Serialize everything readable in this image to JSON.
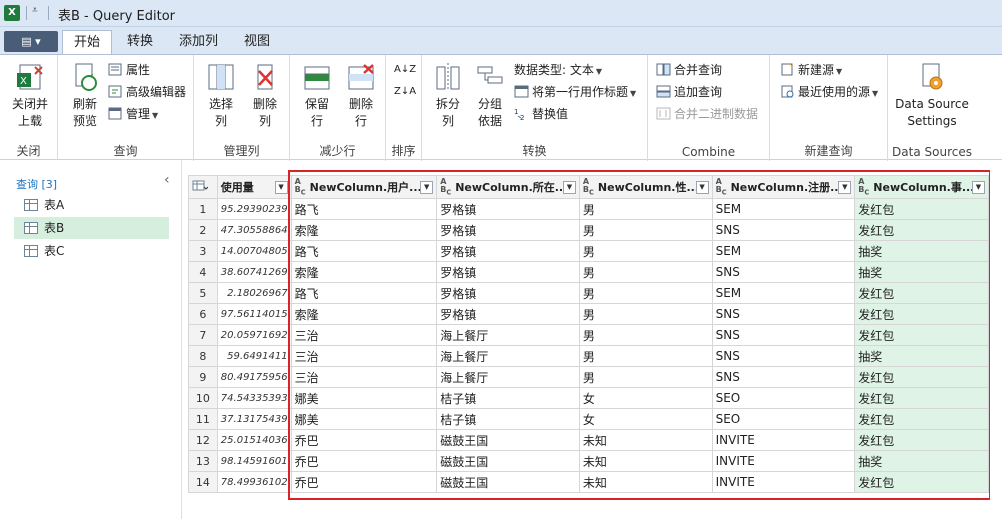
{
  "window": {
    "title": "表B - Query Editor",
    "app_icon": "excel-icon"
  },
  "ribbon_tabs": {
    "file": "▤ ▾",
    "tabs": [
      "开始",
      "转换",
      "添加列",
      "视图"
    ],
    "active": "开始"
  },
  "groups": {
    "close": {
      "label": "关闭",
      "close_load": "关闭并\n上载",
      "close_load_caret": "▾"
    },
    "query": {
      "label": "查询",
      "refresh": "刷新\n预览",
      "properties": "属性",
      "advanced_editor": "高级编辑器",
      "manage": "管理"
    },
    "manage_cols": {
      "label": "管理列",
      "choose_cols": "选择\n列",
      "remove_cols": "删除\n列"
    },
    "reduce_rows": {
      "label": "减少行",
      "keep_rows": "保留\n行",
      "remove_rows": "删除\n行"
    },
    "sort": {
      "label": "排序",
      "asc": "A↓Z",
      "desc": "Z↓A"
    },
    "transform": {
      "label": "转换",
      "split_col": "拆分\n列",
      "group_by": "分组\n依据",
      "data_type": "数据类型: 文本",
      "first_row_header": "将第一行用作标题",
      "replace_values": "替换值"
    },
    "combine": {
      "label": "Combine",
      "merge_queries": "合并查询",
      "append_queries": "追加查询",
      "combine_binaries": "合并二进制数据"
    },
    "new_query": {
      "label": "新建查询",
      "new_source": "新建源",
      "recent_sources": "最近使用的源"
    },
    "data_sources": {
      "label": "Data Sources",
      "settings": "Data Source\nSettings"
    }
  },
  "queries_pane": {
    "header": "查询 [3]",
    "collapse": "‹",
    "items": [
      "表A",
      "表B",
      "表C"
    ],
    "selected": "表B"
  },
  "table": {
    "columns": [
      {
        "name": "使用量",
        "type": "number"
      },
      {
        "name": "NewColumn.用户...",
        "type": "text"
      },
      {
        "name": "NewColumn.所在...",
        "type": "text"
      },
      {
        "name": "NewColumn.性...",
        "type": "text"
      },
      {
        "name": "NewColumn.注册...",
        "type": "text"
      },
      {
        "name": "NewColumn.事...",
        "type": "text"
      }
    ],
    "rows": [
      [
        "1",
        "95.29390239",
        "路飞",
        "罗格镇",
        "男",
        "SEM",
        "发红包"
      ],
      [
        "2",
        "47.30558864",
        "索隆",
        "罗格镇",
        "男",
        "SNS",
        "发红包"
      ],
      [
        "3",
        "14.00704805",
        "路飞",
        "罗格镇",
        "男",
        "SEM",
        "抽奖"
      ],
      [
        "4",
        "38.60741269",
        "索隆",
        "罗格镇",
        "男",
        "SNS",
        "抽奖"
      ],
      [
        "5",
        "2.18026967",
        "路飞",
        "罗格镇",
        "男",
        "SEM",
        "发红包"
      ],
      [
        "6",
        "97.56114015",
        "索隆",
        "罗格镇",
        "男",
        "SNS",
        "发红包"
      ],
      [
        "7",
        "20.05971692",
        "三治",
        "海上餐厅",
        "男",
        "SNS",
        "发红包"
      ],
      [
        "8",
        "59.6491411",
        "三治",
        "海上餐厅",
        "男",
        "SNS",
        "抽奖"
      ],
      [
        "9",
        "80.49175956",
        "三治",
        "海上餐厅",
        "男",
        "SNS",
        "发红包"
      ],
      [
        "10",
        "74.54335393",
        "娜美",
        "桔子镇",
        "女",
        "SEO",
        "发红包"
      ],
      [
        "11",
        "37.13175439",
        "娜美",
        "桔子镇",
        "女",
        "SEO",
        "发红包"
      ],
      [
        "12",
        "25.01514036",
        "乔巴",
        "磁鼓王国",
        "未知",
        "INVITE",
        "发红包"
      ],
      [
        "13",
        "98.14591601",
        "乔巴",
        "磁鼓王国",
        "未知",
        "INVITE",
        "抽奖"
      ],
      [
        "14",
        "78.49936102",
        "乔巴",
        "磁鼓王国",
        "未知",
        "INVITE",
        "发红包"
      ]
    ]
  },
  "colors": {
    "accent_green": "#dff4e6",
    "selection_red": "#d9232b",
    "ribbon_blue": "#dbe7f4"
  }
}
